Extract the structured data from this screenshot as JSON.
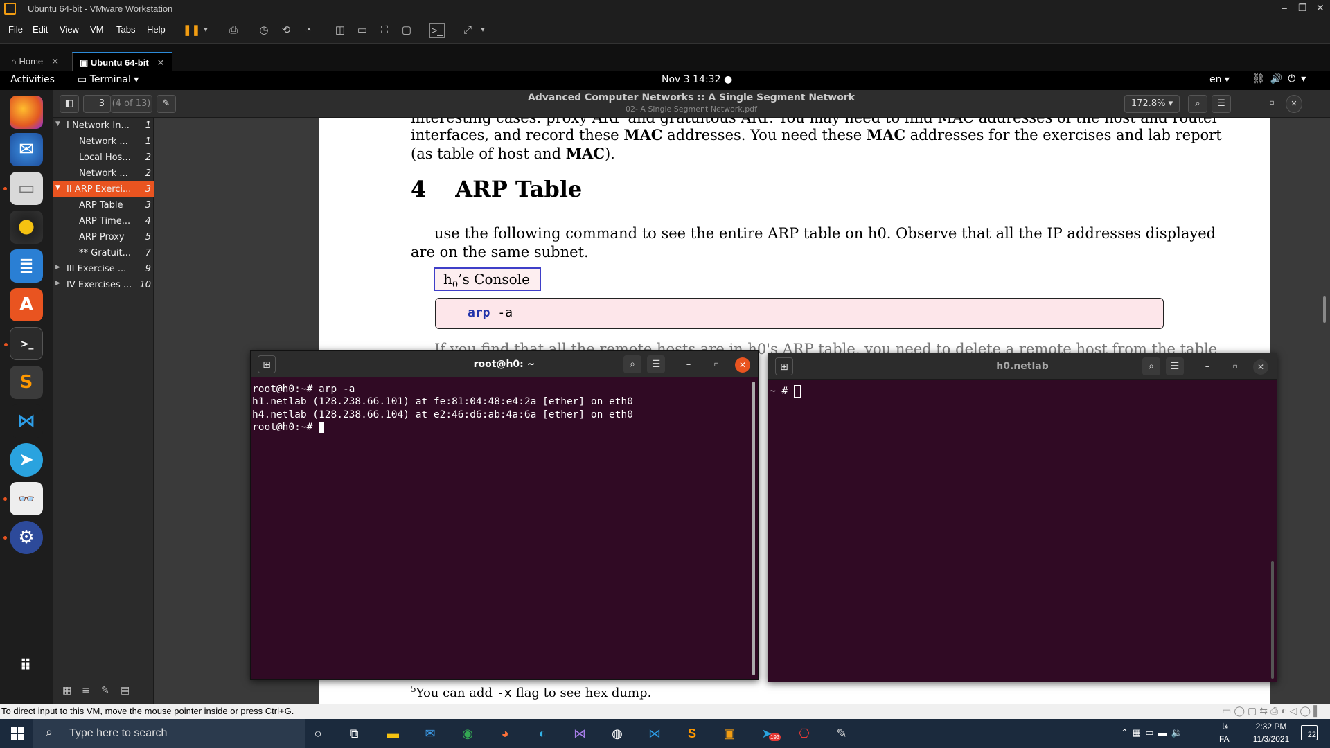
{
  "vmware": {
    "title": "Ubuntu 64-bit - VMware Workstation",
    "menu": [
      "File",
      "Edit",
      "View",
      "VM",
      "Tabs",
      "Help"
    ],
    "tabs": [
      {
        "label": "Home"
      },
      {
        "label": "Ubuntu 64-bit"
      }
    ],
    "status_message": "To direct input to this VM, move the mouse pointer inside or press Ctrl+G."
  },
  "ubuntu_top": {
    "activities": "Activities",
    "app_menu": "Terminal ▾",
    "clock": "Nov 3  14:32",
    "language": "en ▾"
  },
  "dock": {
    "apps": [
      "Firefox",
      "Thunderbird",
      "Files",
      "Rhythmbox",
      "LibreOffice Writer",
      "Ubuntu Software",
      "Terminal",
      "Sublime Text",
      "Visual Studio Code",
      "Telegram",
      "Document Viewer",
      "GNOME Builder",
      "Show Applications"
    ]
  },
  "evince": {
    "title": "Advanced Computer Networks :: A Single Segment Network",
    "subtitle": "02- A Single Segment Network.pdf",
    "page_number": "3",
    "page_count": "(4 of 13)",
    "zoom": "172.8%",
    "outline": [
      {
        "label": "I Network In...",
        "page": "1",
        "level": 0,
        "expander": "▼"
      },
      {
        "label": "Network ...",
        "page": "1",
        "level": 1
      },
      {
        "label": "Local Hos...",
        "page": "2",
        "level": 1
      },
      {
        "label": "Network ...",
        "page": "2",
        "level": 1
      },
      {
        "label": "II ARP Exerci...",
        "page": "3",
        "level": 0,
        "expander": "▼",
        "selected": true
      },
      {
        "label": "ARP Table",
        "page": "3",
        "level": 1
      },
      {
        "label": "ARP Time...",
        "page": "4",
        "level": 1
      },
      {
        "label": "ARP Proxy",
        "page": "5",
        "level": 1
      },
      {
        "label": "** Gratuit...",
        "page": "7",
        "level": 1
      },
      {
        "label": "III Exercise ...",
        "page": "9",
        "level": 0,
        "expander": "▶"
      },
      {
        "label": "IV Exercises ...",
        "page": "10",
        "level": 0,
        "expander": "▶"
      }
    ],
    "pdf": {
      "line_top": "interesting cases: proxy ARP and gratuitous ARP. You may need to find MAC addresses of the host and router",
      "line1_a": "interfaces, and record these ",
      "line1_b": "MAC",
      "line1_c": " addresses. You need these ",
      "line1_d": "MAC",
      "line1_e": " addresses for the exercises and lab report",
      "line2_a": "(as table of host and ",
      "line2_b": "MAC",
      "line2_c": ").",
      "section_number": "4",
      "section_title": "ARP Table",
      "para1": "use the following command to see the entire ARP table on h0. Observe that all the IP addresses displayed",
      "para2": "are on the same subnet.",
      "console_label": "h",
      "console_sub": "0",
      "console_rest": "’s Console",
      "command_kw": "arp",
      "command_arg": " -a",
      "line_behind": "If you find that all the remote hosts are in h0's ARP table, you need to delete a remote host from the table",
      "footnote_mark": "5",
      "footnote_a": "You can add",
      "footnote_code": "-x",
      "footnote_b": "flag to see hex dump."
    }
  },
  "terminal_left": {
    "title": "root@h0: ~",
    "lines": [
      "root@h0:~# arp -a",
      "h1.netlab (128.238.66.101) at fe:81:04:48:e4:2a [ether] on eth0",
      "h4.netlab (128.238.66.104) at e2:46:d6:ab:4a:6a [ether] on eth0"
    ],
    "prompt": "root@h0:~# "
  },
  "terminal_right": {
    "title": "h0.netlab",
    "prompt": "~ # "
  },
  "taskbar": {
    "search_placeholder": "Type here to search",
    "lang_top": "فا",
    "lang_bottom": "FA",
    "time": "2:32 PM",
    "date": "11/3/2021",
    "notifications": "22",
    "telegram_badge": "193"
  }
}
